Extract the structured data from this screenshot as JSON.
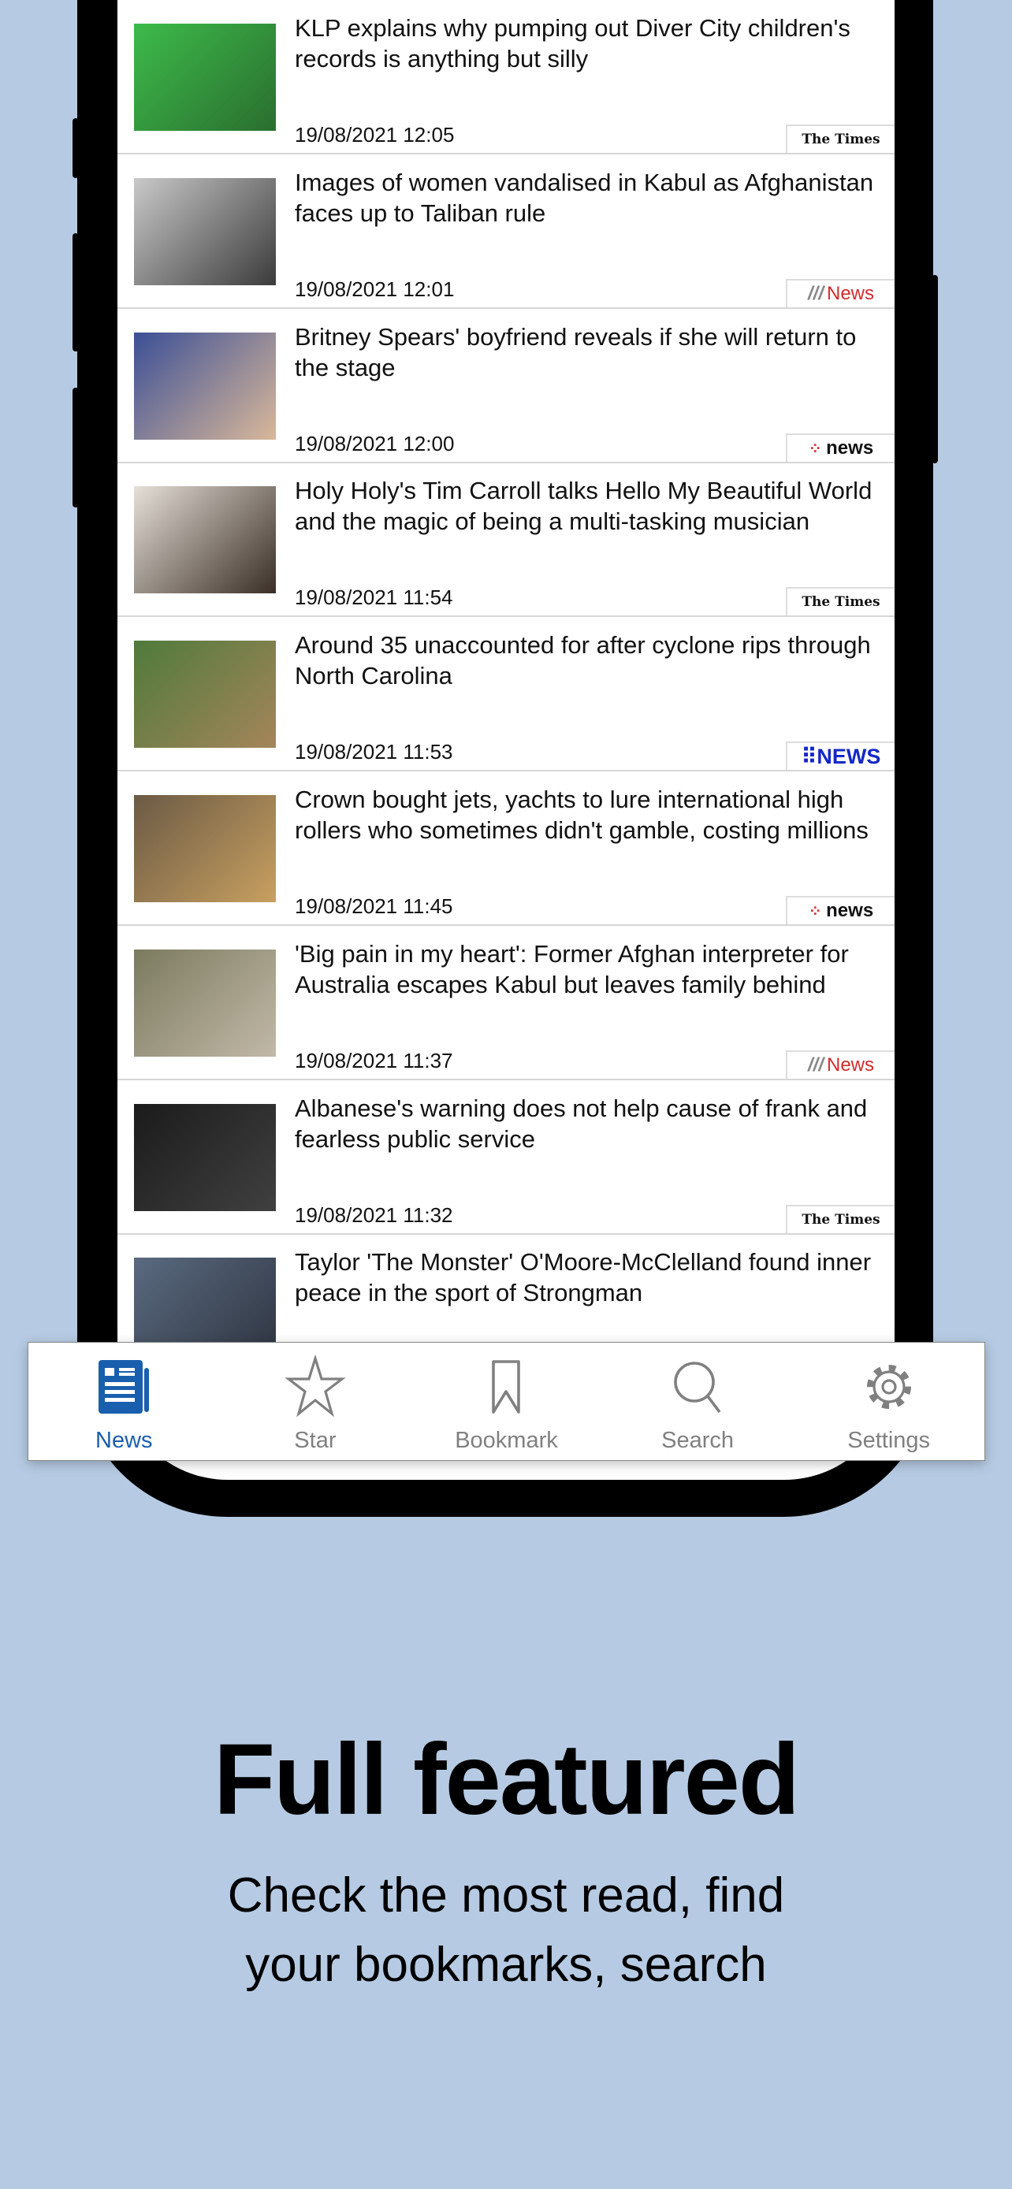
{
  "articles": [
    {
      "title": "KLP explains why pumping out Diver City children's records is anything but silly",
      "date": "19/08/2021 12:05",
      "source": "The Times",
      "source_style": "times",
      "thumb_colors": [
        "#3dbb4a",
        "#2a6e2f"
      ]
    },
    {
      "title": "Images of women vandalised in Kabul as Afghanistan faces up to Taliban rule",
      "date": "19/08/2021 12:01",
      "source": "News",
      "source_style": "sbs",
      "thumb_colors": [
        "#c9c9c9",
        "#3b3b3b"
      ]
    },
    {
      "title": "Britney Spears' boyfriend reveals if she will return to the stage",
      "date": "19/08/2021 12:00",
      "source": "news",
      "source_style": "seven",
      "thumb_colors": [
        "#3b4f96",
        "#d9b89a"
      ]
    },
    {
      "title": "Holy Holy's Tim Carroll talks Hello My Beautiful World and the magic of being a multi-tasking musician",
      "date": "19/08/2021 11:54",
      "source": "The Times",
      "source_style": "times",
      "thumb_colors": [
        "#e6e0d8",
        "#3a2e26"
      ]
    },
    {
      "title": "Around 35 unaccounted for after cyclone rips through North Carolina",
      "date": "19/08/2021 11:53",
      "source": "NEWS",
      "source_style": "nine",
      "thumb_colors": [
        "#4f7a3b",
        "#a5855a"
      ]
    },
    {
      "title": "Crown bought jets, yachts to lure international high rollers who sometimes didn't gamble, costing millions",
      "date": "19/08/2021 11:45",
      "source": "news",
      "source_style": "seven",
      "thumb_colors": [
        "#6b5a45",
        "#c8a060"
      ]
    },
    {
      "title": "'Big pain in my heart': Former Afghan interpreter for Australia escapes Kabul but leaves family behind",
      "date": "19/08/2021 11:37",
      "source": "News",
      "source_style": "sbs",
      "thumb_colors": [
        "#7b7a5e",
        "#c2b9a8"
      ]
    },
    {
      "title": "Albanese's warning does not help cause of frank and fearless public service",
      "date": "19/08/2021 11:32",
      "source": "The Times",
      "source_style": "times",
      "thumb_colors": [
        "#1b1b1b",
        "#404040"
      ]
    },
    {
      "title": "Taylor 'The Monster' O'Moore-McClelland found inner peace in the sport of Strongman",
      "date": "",
      "source": "",
      "source_style": "",
      "thumb_colors": [
        "#5a6a80",
        "#2e3440"
      ]
    }
  ],
  "tabbar": {
    "active": "news",
    "accent": "#1a5fae",
    "items": [
      {
        "id": "news",
        "label": "News",
        "icon": "newspaper-icon"
      },
      {
        "id": "star",
        "label": "Star",
        "icon": "star-icon"
      },
      {
        "id": "bookmark",
        "label": "Bookmark",
        "icon": "bookmark-icon"
      },
      {
        "id": "search",
        "label": "Search",
        "icon": "search-icon"
      },
      {
        "id": "settings",
        "label": "Settings",
        "icon": "gear-icon"
      }
    ]
  },
  "promo": {
    "headline": "Full featured",
    "subtitle_line1": "Check the most read, find",
    "subtitle_line2": "your bookmarks, search"
  }
}
